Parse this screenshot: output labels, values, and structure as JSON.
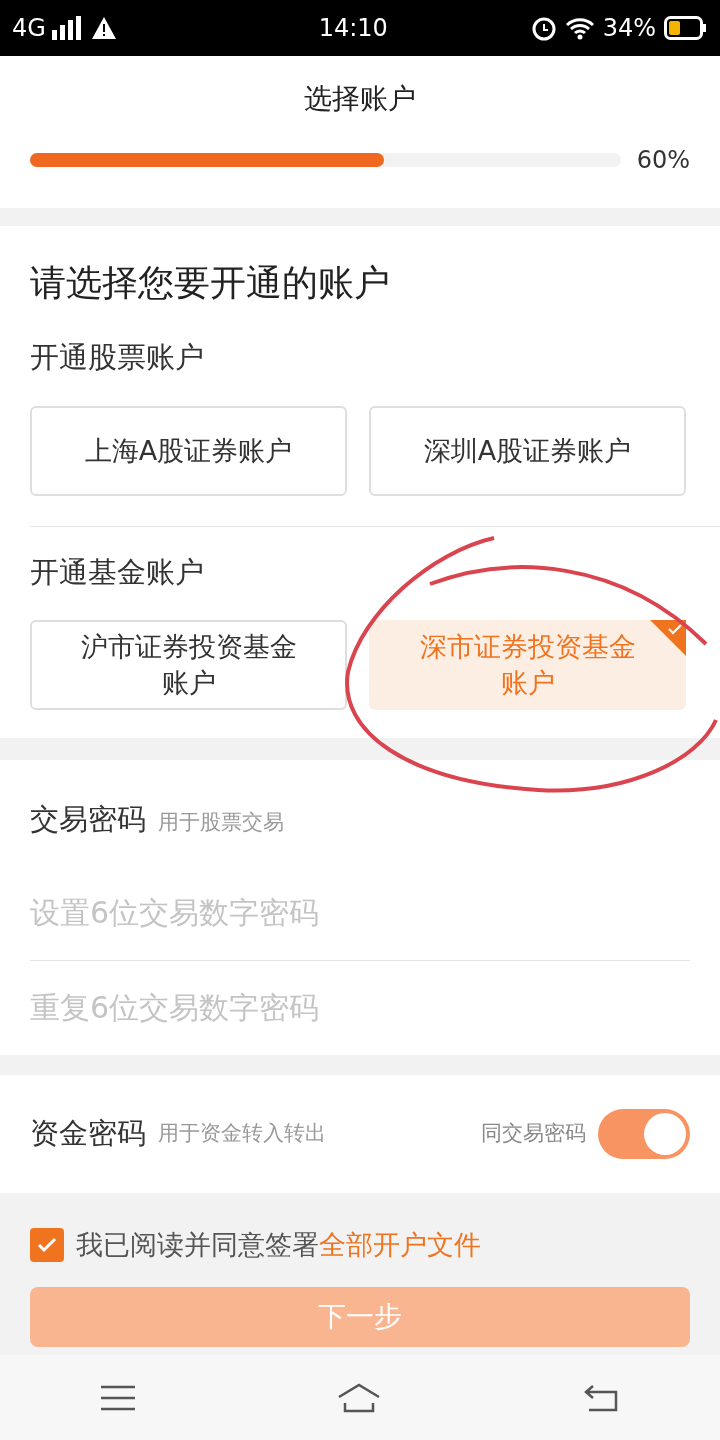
{
  "status_bar": {
    "network": "4G",
    "time": "14:10",
    "battery": "34%"
  },
  "header": {
    "title": "选择账户"
  },
  "progress": {
    "level": 0.6,
    "reading": "60%"
  },
  "accounts": {
    "title": "请选择您要开通的账户",
    "groups": [
      {
        "label": "开通股票账户",
        "options": [
          {
            "label": "上海A股证券账户",
            "selected": false
          },
          {
            "label": "深圳A股证券账户",
            "selected": false
          }
        ]
      },
      {
        "label": "开通基金账户",
        "options": [
          {
            "label": "沪市证券投资基金账户",
            "selected": false
          },
          {
            "label": "深市证券投资基金账户",
            "selected": true
          }
        ]
      }
    ]
  },
  "trade_password": {
    "label": "交易密码",
    "hint": "用于股票交易",
    "fields": [
      {
        "placeholder": "设置6位交易数字密码"
      },
      {
        "placeholder": "重复6位交易数字密码"
      }
    ]
  },
  "fund_password": {
    "label": "资金密码",
    "hint": "用于资金转入转出",
    "toggle_label": "同交易密码",
    "on": true
  },
  "agreement": {
    "checked": true,
    "text": "我已阅读并同意签署",
    "link": "全部开户文件"
  },
  "next_button": "下一步"
}
